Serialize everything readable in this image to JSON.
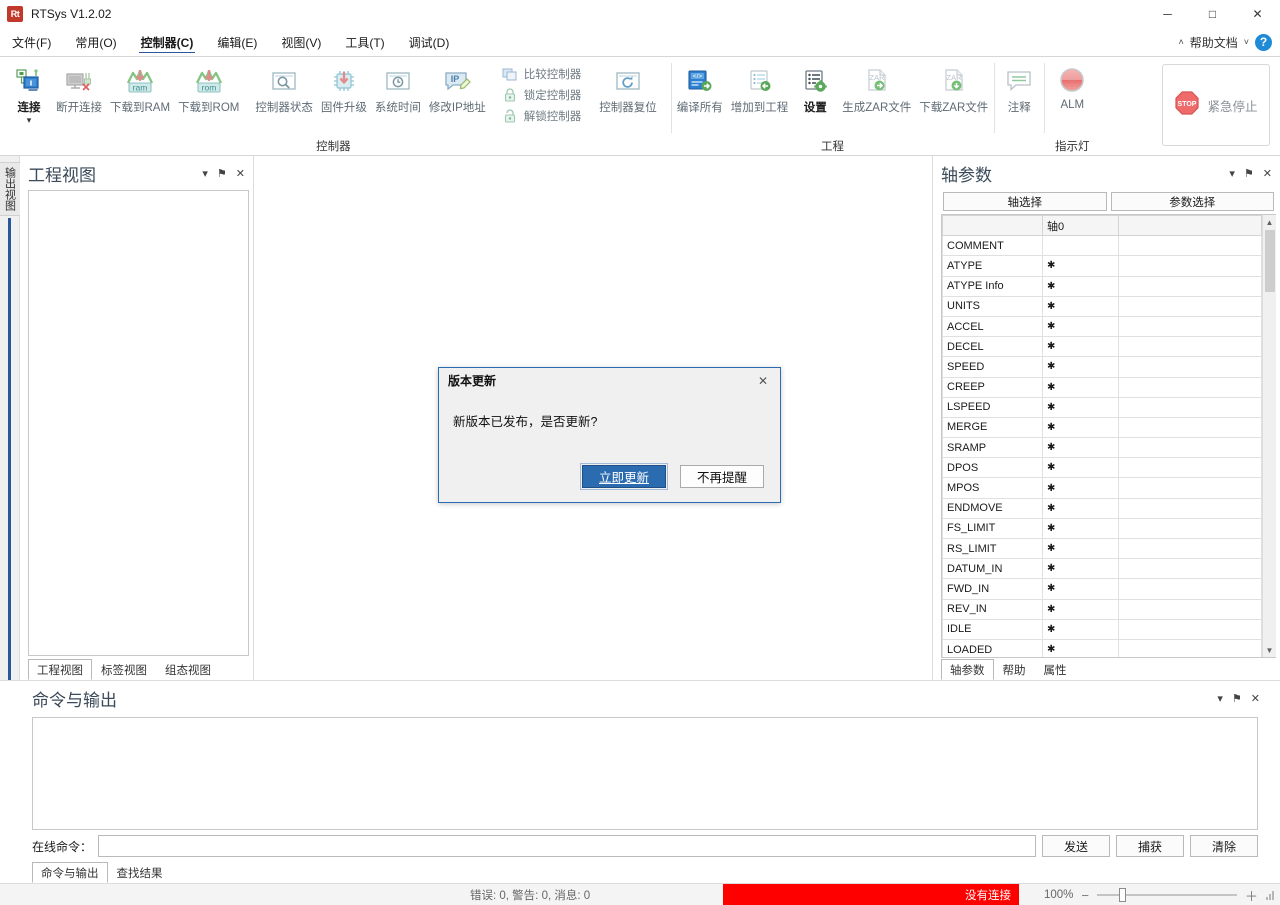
{
  "window": {
    "app_icon": "rtsys-logo-icon",
    "title": "RTSys V1.2.02",
    "minimize": "─",
    "maximize": "□",
    "close": "✕"
  },
  "menubar": {
    "items": [
      {
        "label": "文件(F)",
        "active": false
      },
      {
        "label": "常用(O)",
        "active": false
      },
      {
        "label": "控制器(C)",
        "active": true
      },
      {
        "label": "编辑(E)",
        "active": false
      },
      {
        "label": "视图(V)",
        "active": false
      },
      {
        "label": "工具(T)",
        "active": false
      },
      {
        "label": "调试(D)",
        "active": false
      }
    ],
    "collapse_caret": "˄",
    "help_label": "帮助文档",
    "help_caret": "˅",
    "help_icon": "help-circle-icon"
  },
  "ribbon": {
    "groups": [
      {
        "name": "controller",
        "title": "控制器",
        "buttons": [
          {
            "label": "连接",
            "icon": "connect-icon",
            "enabled": true,
            "has_caret": true
          },
          {
            "label": "断开连接",
            "icon": "disconnect-icon",
            "enabled": false
          },
          {
            "label": "下载到RAM",
            "icon": "download-ram-icon",
            "enabled": false
          },
          {
            "label": "下载到ROM",
            "icon": "download-rom-icon",
            "enabled": false
          },
          {
            "label": "控制器状态",
            "icon": "controller-status-icon",
            "enabled": false
          },
          {
            "label": "固件升级",
            "icon": "firmware-upgrade-icon",
            "enabled": false
          },
          {
            "label": "系统时间",
            "icon": "system-time-icon",
            "enabled": false
          },
          {
            "label": "修改IP地址",
            "icon": "modify-ip-icon",
            "enabled": false
          },
          {
            "label": "控制器复位",
            "icon": "controller-reset-icon",
            "enabled": false
          }
        ],
        "small_buttons": [
          {
            "label": "比较控制器",
            "icon": "compare-controller-icon"
          },
          {
            "label": "锁定控制器",
            "icon": "lock-controller-icon"
          },
          {
            "label": "解锁控制器",
            "icon": "unlock-controller-icon"
          }
        ]
      },
      {
        "name": "project",
        "title": "工程",
        "buttons": [
          {
            "label": "编译所有",
            "icon": "compile-all-icon",
            "enabled": false
          },
          {
            "label": "增加到工程",
            "icon": "add-to-project-icon",
            "enabled": false
          },
          {
            "label": "设置",
            "icon": "settings-icon",
            "enabled": true,
            "bold": true
          },
          {
            "label": "生成ZAR文件",
            "icon": "generate-zar-icon",
            "enabled": false
          },
          {
            "label": "下载ZAR文件",
            "icon": "download-zar-icon",
            "enabled": false
          },
          {
            "label": "注释",
            "icon": "comment-icon",
            "enabled": false
          }
        ]
      },
      {
        "name": "indicator",
        "title": "指示灯",
        "buttons": [
          {
            "label": "ALM",
            "icon": "alarm-lamp-icon",
            "enabled": false
          }
        ]
      }
    ],
    "emergency_stop": {
      "label": "紧急停止",
      "icon": "emergency-stop-icon",
      "badge": "STOP"
    }
  },
  "left_strip": {
    "vertical_tab": "输出视图"
  },
  "project_panel": {
    "title": "工程视图",
    "head_buttons": [
      {
        "name": "dropdown-icon",
        "glyph": "▾"
      },
      {
        "name": "pin-icon",
        "glyph": "⚑"
      },
      {
        "name": "close-icon",
        "glyph": "✕"
      }
    ],
    "tabs": [
      {
        "label": "工程视图",
        "active": true
      },
      {
        "label": "标签视图",
        "active": false
      },
      {
        "label": "组态视图",
        "active": false
      }
    ]
  },
  "axis_panel": {
    "title": "轴参数",
    "head_buttons": [
      {
        "name": "dropdown-icon",
        "glyph": "▾"
      },
      {
        "name": "pin-icon",
        "glyph": "⚑"
      },
      {
        "name": "close-icon",
        "glyph": "✕"
      }
    ],
    "buttons": [
      {
        "label": "轴选择"
      },
      {
        "label": "参数选择"
      }
    ],
    "columns": [
      "",
      "轴0",
      ""
    ],
    "rows": [
      {
        "name": "COMMENT",
        "value": ""
      },
      {
        "name": "ATYPE",
        "value": "✱"
      },
      {
        "name": "ATYPE Info",
        "value": "✱"
      },
      {
        "name": "UNITS",
        "value": "✱"
      },
      {
        "name": "ACCEL",
        "value": "✱"
      },
      {
        "name": "DECEL",
        "value": "✱"
      },
      {
        "name": "SPEED",
        "value": "✱"
      },
      {
        "name": "CREEP",
        "value": "✱"
      },
      {
        "name": "LSPEED",
        "value": "✱"
      },
      {
        "name": "MERGE",
        "value": "✱"
      },
      {
        "name": "SRAMP",
        "value": "✱"
      },
      {
        "name": "DPOS",
        "value": "✱"
      },
      {
        "name": "MPOS",
        "value": "✱"
      },
      {
        "name": "ENDMOVE",
        "value": "✱"
      },
      {
        "name": "FS_LIMIT",
        "value": "✱"
      },
      {
        "name": "RS_LIMIT",
        "value": "✱"
      },
      {
        "name": "DATUM_IN",
        "value": "✱"
      },
      {
        "name": "FWD_IN",
        "value": "✱"
      },
      {
        "name": "REV_IN",
        "value": "✱"
      },
      {
        "name": "IDLE",
        "value": "✱"
      },
      {
        "name": "LOADED",
        "value": "✱"
      }
    ],
    "tabs": [
      {
        "label": "轴参数",
        "active": true
      },
      {
        "label": "帮助",
        "active": false
      },
      {
        "label": "属性",
        "active": false
      }
    ],
    "scroll_up": "▲",
    "scroll_down": "▼"
  },
  "command_panel": {
    "title": "命令与输出",
    "head_buttons": [
      {
        "name": "dropdown-icon",
        "glyph": "▾"
      },
      {
        "name": "pin-icon",
        "glyph": "⚑"
      },
      {
        "name": "close-icon",
        "glyph": "✕"
      }
    ],
    "output_text": "",
    "online_label": "在线命令：",
    "online_value": "",
    "online_placeholder": "",
    "buttons": [
      {
        "label": "发送"
      },
      {
        "label": "捕获"
      },
      {
        "label": "清除"
      }
    ],
    "tabs": [
      {
        "label": "命令与输出",
        "active": true
      },
      {
        "label": "查找结果",
        "active": false
      }
    ]
  },
  "statusbar": {
    "message": "错误: 0, 警告: 0, 消息: 0",
    "connection": "没有连接",
    "connection_color": "#ff0000",
    "zoom_level": "100%",
    "zoom_minus": "−",
    "zoom_plus": "＋",
    "resize_grip": "resize-grip-icon"
  },
  "dialog": {
    "title": "版本更新",
    "close": "✕",
    "message": "新版本已发布，是否更新?",
    "primary_button": "立即更新",
    "secondary_button": "不再提醒",
    "accent_color": "#2b6cb0"
  }
}
